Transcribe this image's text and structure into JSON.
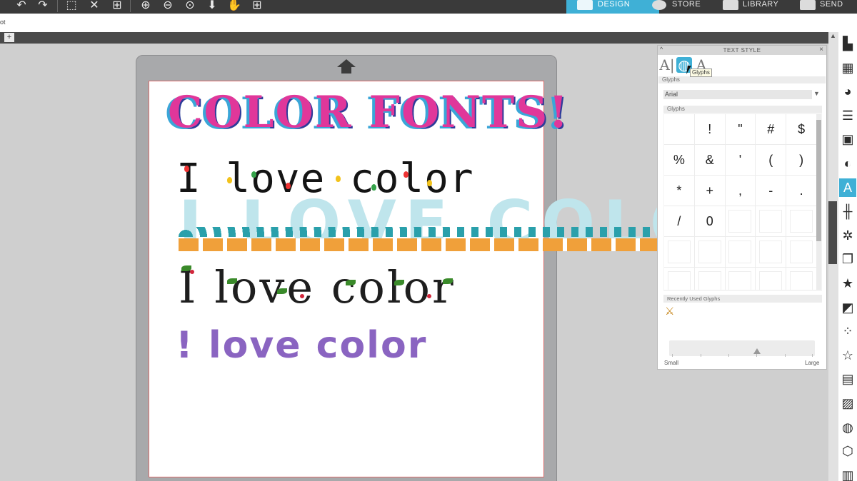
{
  "toolbar": {
    "icons": [
      "undo-icon",
      "redo-icon",
      "select-all-icon",
      "deselect-icon",
      "select-icon",
      "zoom-in-icon",
      "zoom-out-icon",
      "zoom-fit-icon",
      "move-down-icon",
      "pan-icon",
      "fit-page-icon"
    ]
  },
  "nav": {
    "design": "DESIGN",
    "store": "STORE",
    "library": "LIBRARY",
    "send": "SEND"
  },
  "document": {
    "name": "ot",
    "add_tab": "+"
  },
  "canvas": {
    "title": "COLOR FONTS!",
    "line1": "I love color",
    "line2": "I LOVE COLOR",
    "line3": "I love color",
    "line4": "! love color"
  },
  "panel": {
    "title": "TEXT STYLE",
    "collapse": "^",
    "close": "×",
    "tabs": [
      "A|",
      "glyphs",
      "A"
    ],
    "tooltip": "Glyphs",
    "section_glyphs": "Glyphs",
    "font": "Arial",
    "font_caret": "▼",
    "grid_header": "Glyphs",
    "glyphs": [
      "",
      "!",
      "\"",
      "#",
      "$",
      "%",
      "&",
      "'",
      "(",
      ")",
      "*",
      "+",
      ",",
      "-",
      ".",
      "/",
      "0",
      "",
      "",
      "",
      "",
      "",
      "",
      "",
      "",
      "",
      "",
      "",
      "",
      ""
    ],
    "recent_label": "Recently Used Glyphs",
    "recent_glyph": "⚔",
    "size_small": "Small",
    "size_large": "Large",
    "size_level": 0.6
  },
  "sidebar": {
    "icons": [
      "page-setup-icon",
      "pixscan-icon",
      "fill-icon",
      "line-style-icon",
      "image-effects-icon",
      "transparency-icon",
      "text-style-icon",
      "align-icon",
      "offset-icon",
      "replicate-icon",
      "favorites-icon",
      "modify-icon",
      "trace-icon",
      "sketch-icon",
      "layers-icon",
      "fill-pattern-icon",
      "globe-icon",
      "3d-box-icon",
      "library-icon"
    ],
    "active": "text-style-icon"
  }
}
